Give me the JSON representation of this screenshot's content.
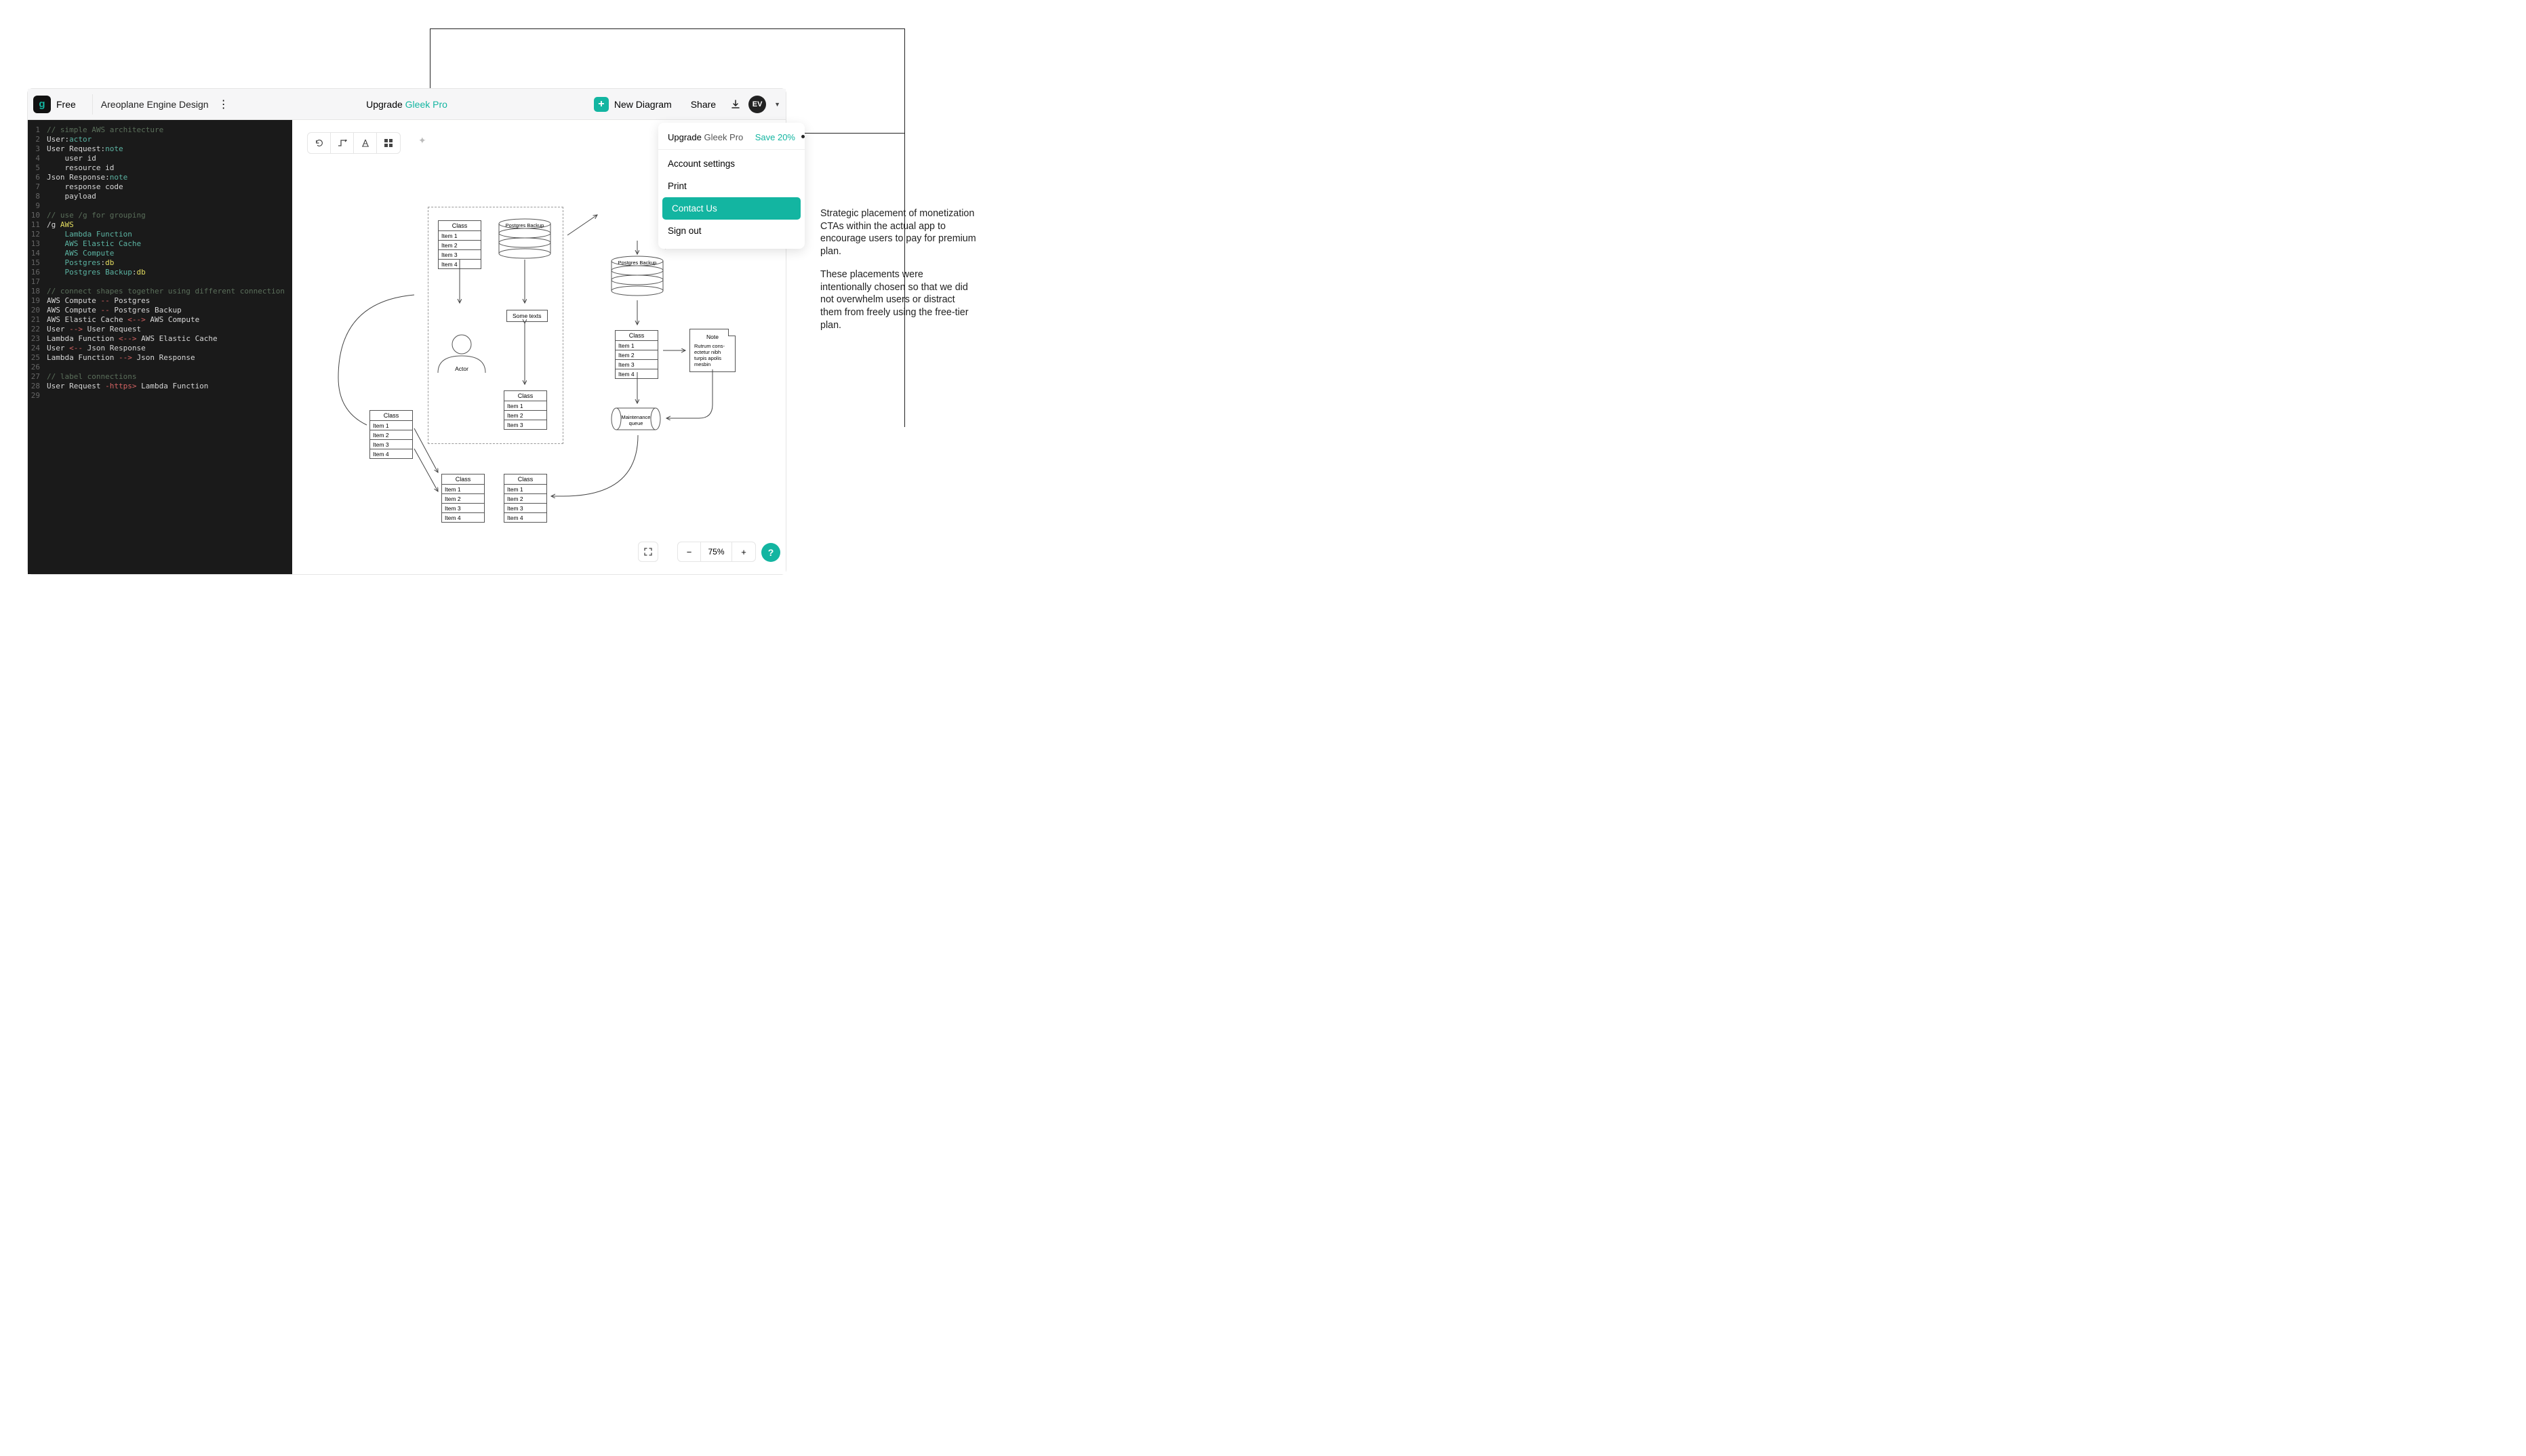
{
  "topbar": {
    "logo_glyph": "g",
    "tier": "Free",
    "doc_title": "Areoplane Engine Design",
    "upgrade_prefix": "Upgrade ",
    "upgrade_product": "Gleek Pro",
    "new_diagram": "New Diagram",
    "share": "Share",
    "avatar": "EV"
  },
  "dropdown": {
    "upgrade_prefix": "Upgrade ",
    "upgrade_product": "Gleek Pro",
    "save_badge": "Save 20%",
    "account": "Account settings",
    "print": "Print",
    "contact": "Contact Us",
    "signout": "Sign out"
  },
  "code_lines": [
    {
      "n": "1",
      "segs": [
        {
          "c": "tok-comment",
          "t": "// simple AWS architecture"
        }
      ]
    },
    {
      "n": "2",
      "segs": [
        {
          "c": "tok-plain",
          "t": "User"
        },
        {
          "c": "tok-plain",
          "t": ":"
        },
        {
          "c": "tok-type",
          "t": "actor"
        }
      ]
    },
    {
      "n": "3",
      "segs": [
        {
          "c": "tok-plain",
          "t": "User Request"
        },
        {
          "c": "tok-plain",
          "t": ":"
        },
        {
          "c": "tok-type",
          "t": "note"
        }
      ]
    },
    {
      "n": "4",
      "segs": [
        {
          "c": "tok-plain",
          "t": "    user id"
        }
      ]
    },
    {
      "n": "5",
      "segs": [
        {
          "c": "tok-plain",
          "t": "    resource id"
        }
      ]
    },
    {
      "n": "6",
      "segs": [
        {
          "c": "tok-plain",
          "t": "Json Response"
        },
        {
          "c": "tok-plain",
          "t": ":"
        },
        {
          "c": "tok-type",
          "t": "note"
        }
      ]
    },
    {
      "n": "7",
      "segs": [
        {
          "c": "tok-plain",
          "t": "    response code"
        }
      ]
    },
    {
      "n": "8",
      "segs": [
        {
          "c": "tok-plain",
          "t": "    payload"
        }
      ]
    },
    {
      "n": "9",
      "segs": [
        {
          "c": "",
          "t": ""
        }
      ]
    },
    {
      "n": "10",
      "segs": [
        {
          "c": "tok-comment",
          "t": "// use /g for grouping"
        }
      ]
    },
    {
      "n": "11",
      "segs": [
        {
          "c": "tok-plain",
          "t": "/g "
        },
        {
          "c": "tok-keyword",
          "t": "AWS"
        }
      ]
    },
    {
      "n": "12",
      "segs": [
        {
          "c": "tok-type",
          "t": "    Lambda Function"
        }
      ]
    },
    {
      "n": "13",
      "segs": [
        {
          "c": "tok-type",
          "t": "    AWS Elastic Cache"
        }
      ]
    },
    {
      "n": "14",
      "segs": [
        {
          "c": "tok-type",
          "t": "    AWS Compute"
        }
      ]
    },
    {
      "n": "15",
      "segs": [
        {
          "c": "tok-type",
          "t": "    Postgres"
        },
        {
          "c": "tok-plain",
          "t": ":"
        },
        {
          "c": "tok-keyword",
          "t": "db"
        }
      ]
    },
    {
      "n": "16",
      "segs": [
        {
          "c": "tok-type",
          "t": "    Postgres Backup"
        },
        {
          "c": "tok-plain",
          "t": ":"
        },
        {
          "c": "tok-keyword",
          "t": "db"
        }
      ]
    },
    {
      "n": "17",
      "segs": [
        {
          "c": "",
          "t": ""
        }
      ]
    },
    {
      "n": "18",
      "segs": [
        {
          "c": "tok-comment",
          "t": "// connect shapes together using different connection"
        }
      ]
    },
    {
      "n": "19",
      "segs": [
        {
          "c": "tok-plain",
          "t": "AWS Compute "
        },
        {
          "c": "tok-arrow",
          "t": "-- "
        },
        {
          "c": "tok-plain",
          "t": "Postgres"
        }
      ]
    },
    {
      "n": "20",
      "segs": [
        {
          "c": "tok-plain",
          "t": "AWS Compute "
        },
        {
          "c": "tok-arrow",
          "t": "-- "
        },
        {
          "c": "tok-plain",
          "t": "Postgres Backup"
        }
      ]
    },
    {
      "n": "21",
      "segs": [
        {
          "c": "tok-plain",
          "t": "AWS Elastic Cache "
        },
        {
          "c": "tok-arrow",
          "t": "<--> "
        },
        {
          "c": "tok-plain",
          "t": "AWS Compute"
        }
      ]
    },
    {
      "n": "22",
      "segs": [
        {
          "c": "tok-plain",
          "t": "User "
        },
        {
          "c": "tok-arrow",
          "t": "--> "
        },
        {
          "c": "tok-plain",
          "t": "User Request"
        }
      ]
    },
    {
      "n": "23",
      "segs": [
        {
          "c": "tok-plain",
          "t": "Lambda Function "
        },
        {
          "c": "tok-arrow",
          "t": "<--> "
        },
        {
          "c": "tok-plain",
          "t": "AWS Elastic Cache"
        }
      ]
    },
    {
      "n": "24",
      "segs": [
        {
          "c": "tok-plain",
          "t": "User "
        },
        {
          "c": "tok-arrow",
          "t": "<-- "
        },
        {
          "c": "tok-plain",
          "t": "Json Response"
        }
      ]
    },
    {
      "n": "25",
      "segs": [
        {
          "c": "tok-plain",
          "t": "Lambda Function "
        },
        {
          "c": "tok-arrow",
          "t": "--> "
        },
        {
          "c": "tok-plain",
          "t": "Json Response"
        }
      ]
    },
    {
      "n": "26",
      "segs": [
        {
          "c": "",
          "t": ""
        }
      ]
    },
    {
      "n": "27",
      "segs": [
        {
          "c": "tok-comment",
          "t": "// label connections"
        }
      ]
    },
    {
      "n": "28",
      "segs": [
        {
          "c": "tok-plain",
          "t": "User Request "
        },
        {
          "c": "tok-arrow",
          "t": "-"
        },
        {
          "c": "tok-label",
          "t": "https"
        },
        {
          "c": "tok-arrow",
          "t": "> "
        },
        {
          "c": "tok-plain",
          "t": "Lambda Function"
        }
      ]
    },
    {
      "n": "29",
      "segs": [
        {
          "c": "",
          "t": ""
        }
      ]
    }
  ],
  "diagram": {
    "class_a": {
      "head": "Class",
      "rows": [
        "Item 1",
        "Item 2",
        "Item 3",
        "Item 4"
      ]
    },
    "class_b": {
      "head": "Class",
      "rows": [
        "Item 1",
        "Item 2",
        "Item 3",
        "Item 4"
      ]
    },
    "class_c": {
      "head": "Class",
      "rows": [
        "Item 1",
        "Item 2",
        "Item 3"
      ]
    },
    "class_d": {
      "head": "Class",
      "rows": [
        "Item 1",
        "Item 2",
        "Item 3",
        "Item 4"
      ]
    },
    "class_e": {
      "head": "Class",
      "rows": [
        "Item 1",
        "Item 2",
        "Item 3",
        "Item 4"
      ]
    },
    "class_f": {
      "head": "Class",
      "rows": [
        "Item 1",
        "Item 2",
        "Item 3",
        "Item 4"
      ]
    },
    "cyl_a": "Postgres Backup",
    "cyl_b": "Postgres Backup",
    "cyl_c": "Maintenance\nqueue",
    "actor_label": "Actor",
    "some_texts": "Some texts",
    "note_head": "Note",
    "note_body": "Rutrum cons-\nectetur nibh\nturpis apolis\nmesbin"
  },
  "zoom": {
    "level": "75%"
  },
  "annotation": {
    "p1": "Strategic placement of monetization CTAs within the actual app to encourage users to pay for premium plan.",
    "p2": "These placements were intentionally chosen so that we did not overwhelm users or distract them from freely using the free-tier plan."
  }
}
